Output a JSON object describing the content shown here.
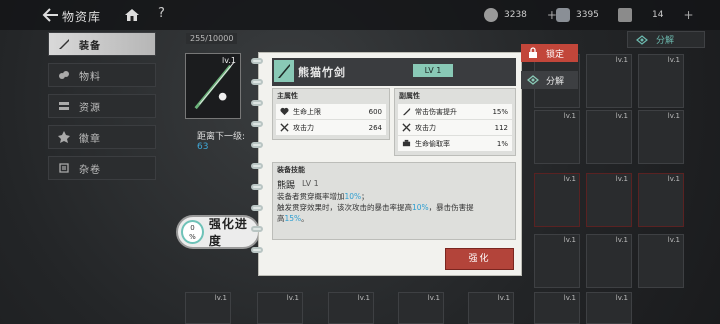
{
  "header": {
    "title": "物资库"
  },
  "resources": [
    {
      "icon": "gear-coin-icon",
      "value": "3238"
    },
    {
      "icon": "crystal-icon",
      "value": "3395"
    },
    {
      "icon": "ticket-icon",
      "value": "14"
    }
  ],
  "sidebar": {
    "items": [
      {
        "label": "装备",
        "icon": "equipment-icon",
        "active": true
      },
      {
        "label": "物料",
        "icon": "materials-icon",
        "active": false
      },
      {
        "label": "资源",
        "icon": "resources-icon",
        "active": false
      },
      {
        "label": "徽章",
        "icon": "badge-icon",
        "active": false
      },
      {
        "label": "杂卷",
        "icon": "scroll-icon",
        "active": false
      }
    ]
  },
  "inventory": {
    "capacity": "255/10000",
    "level_label": "lv.1"
  },
  "selected": {
    "level": "lv.1",
    "next_label": "距离下一级:",
    "next_value": "63",
    "enhance_progress_pct": "0",
    "enhance_progress_label": "强化进度"
  },
  "detail": {
    "name": "熊猫竹剑",
    "level": "LV 1",
    "main_title": "主属性",
    "main_stats": [
      {
        "label": "生命上限",
        "value": "600",
        "icon": "heart-icon"
      },
      {
        "label": "攻击力",
        "value": "264",
        "icon": "swords-icon"
      }
    ],
    "sub_title": "副属性",
    "sub_stats": [
      {
        "label": "常击伤害提升",
        "value": "15%",
        "icon": "blade-icon"
      },
      {
        "label": "攻击力",
        "value": "112",
        "icon": "swords-icon"
      },
      {
        "label": "生命偷取率",
        "value": "1%",
        "icon": "drain-icon"
      }
    ],
    "skill_title": "装备技能",
    "skill_name": "熊踢",
    "skill_level": "LV 1",
    "skill_line1_a": "装备者贯穿概率增加",
    "skill_line1_b": "10%",
    "skill_line1_c": "；",
    "skill_line2_a": "触发贯穿效果时，该次攻击的暴击率提高",
    "skill_line2_b": "10%",
    "skill_line2_c": "，暴击伤害提",
    "skill_line3_a": "高",
    "skill_line3_b": "15%",
    "skill_line3_c": "。",
    "enhance_label": "强化"
  },
  "actions": {
    "lock_label": "锁定",
    "decompose_label": "分解",
    "top_decompose_label": "分解"
  },
  "colors": {
    "accent_teal": "#89c9b6",
    "accent_red": "#b3443a",
    "highlight_blue": "#2e9fd1"
  }
}
